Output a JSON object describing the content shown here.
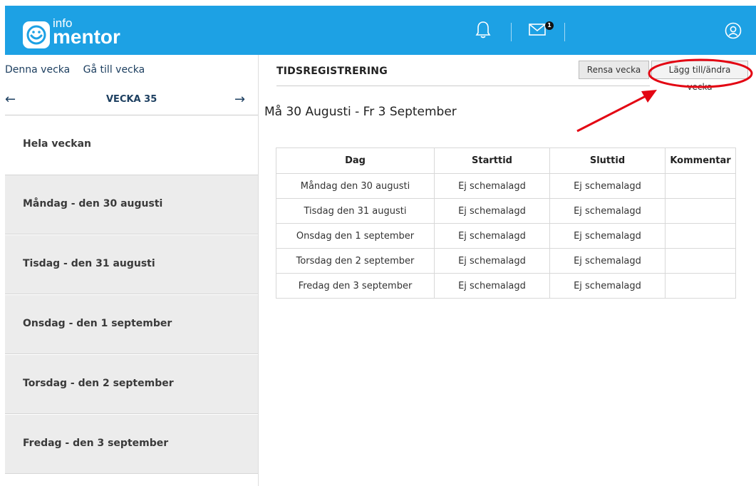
{
  "header": {
    "logo_top": "info",
    "logo_bottom": "mentor",
    "notification_icon": "bell-icon",
    "mail_icon": "mail-icon",
    "mail_badge": "1",
    "user_icon": "user-icon",
    "bar_color": "#1da1e4"
  },
  "sidebar": {
    "this_week": "Denna vecka",
    "go_to_week": "Gå till vecka",
    "prev_icon": "arrow-left-icon",
    "next_icon": "arrow-right-icon",
    "week_label": "VECKA 35",
    "items": [
      {
        "label": "Hela veckan"
      },
      {
        "label": "Måndag - den 30 augusti"
      },
      {
        "label": "Tisdag - den 31 augusti"
      },
      {
        "label": "Onsdag - den 1 september"
      },
      {
        "label": "Torsdag - den 2 september"
      },
      {
        "label": "Fredag - den 3 september"
      }
    ]
  },
  "main": {
    "title": "TIDSREGISTRERING",
    "clear_week": "Rensa vecka",
    "add_edit_week": "Lägg till/ändra vecka",
    "date_range": "Må 30 Augusti - Fr 3 September",
    "table": {
      "headers": [
        "Dag",
        "Starttid",
        "Sluttid",
        "Kommentar"
      ],
      "rows": [
        [
          "Måndag den 30 augusti",
          "Ej schemalagd",
          "Ej schemalagd",
          ""
        ],
        [
          "Tisdag den 31 augusti",
          "Ej schemalagd",
          "Ej schemalagd",
          ""
        ],
        [
          "Onsdag den 1 september",
          "Ej schemalagd",
          "Ej schemalagd",
          ""
        ],
        [
          "Torsdag den 2 september",
          "Ej schemalagd",
          "Ej schemalagd",
          ""
        ],
        [
          "Fredag den 3 september",
          "Ej schemalagd",
          "Ej schemalagd",
          ""
        ]
      ]
    }
  },
  "annotation": {
    "color": "#e30613"
  }
}
